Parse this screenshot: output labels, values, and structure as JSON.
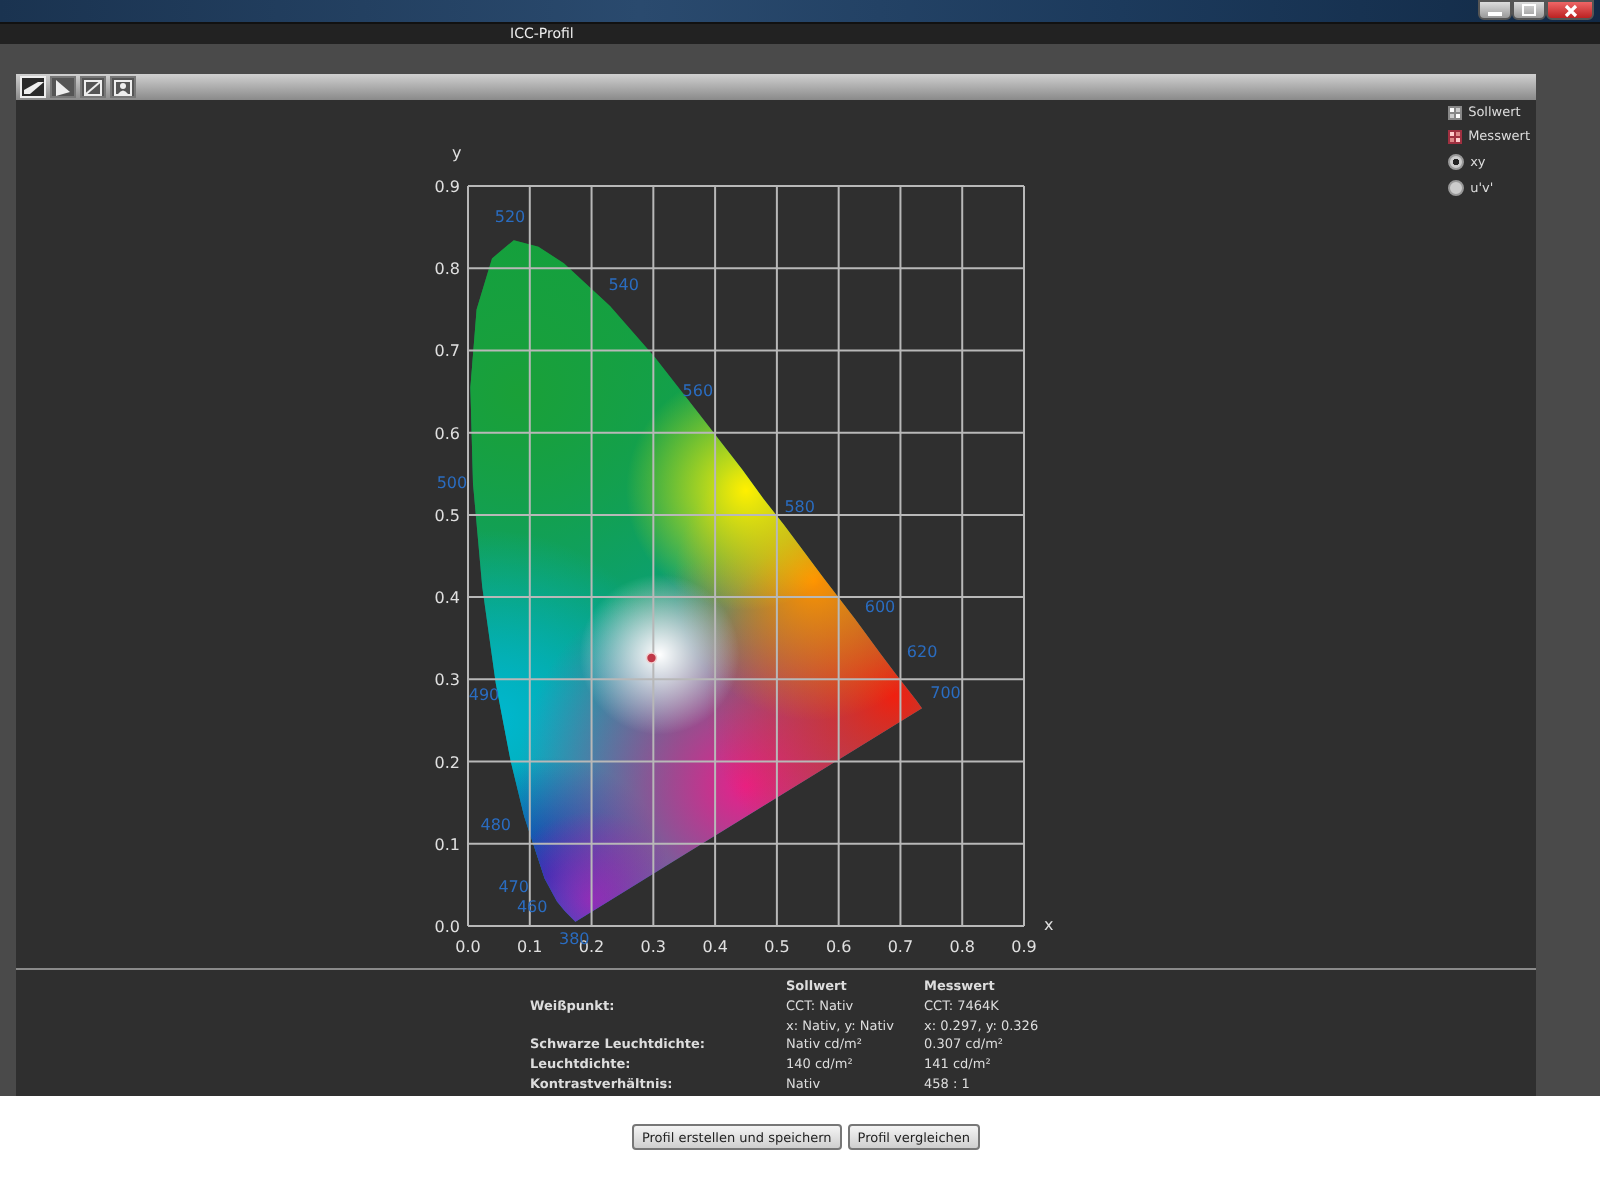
{
  "window": {
    "title": "ICC-Profil"
  },
  "toolbar_tabs": [
    {
      "selected": true
    },
    {
      "selected": false
    },
    {
      "selected": false
    },
    {
      "selected": false
    }
  ],
  "chart": {
    "chart_data": {
      "type": "scatter",
      "grid": true,
      "xlabel": "x",
      "ylabel": "y",
      "xlim": [
        0,
        0.9
      ],
      "ylim": [
        0,
        0.9
      ],
      "xticks": [
        {
          "value": 0,
          "label": "0.0"
        },
        {
          "value": 0.1,
          "label": "0.1"
        },
        {
          "value": 0.2,
          "label": "0.2"
        },
        {
          "value": 0.3,
          "label": "0.3"
        },
        {
          "value": 0.4,
          "label": "0.4"
        },
        {
          "value": 0.5,
          "label": "0.5"
        },
        {
          "value": 0.6,
          "label": "0.6"
        },
        {
          "value": 0.7,
          "label": "0.7"
        },
        {
          "value": 0.8,
          "label": "0.8"
        },
        {
          "value": 0.9,
          "label": "0.9"
        }
      ],
      "yticks": [
        {
          "value": 0,
          "label": "0.0"
        },
        {
          "value": 0.1,
          "label": "0.1"
        },
        {
          "value": 0.2,
          "label": "0.2"
        },
        {
          "value": 0.3,
          "label": "0.3"
        },
        {
          "value": 0.4,
          "label": "0.4"
        },
        {
          "value": 0.5,
          "label": "0.5"
        },
        {
          "value": 0.6,
          "label": "0.6"
        },
        {
          "value": 0.7,
          "label": "0.7"
        },
        {
          "value": 0.8,
          "label": "0.8"
        },
        {
          "value": 0.9,
          "label": "0.9"
        }
      ],
      "series": [
        {
          "color": "#c03848",
          "x": [
            0.297
          ],
          "values": [
            0.326
          ]
        }
      ],
      "annotations": [
        "520",
        "540",
        "560",
        "580",
        "600",
        "620",
        "700",
        "500",
        "490",
        "480",
        "470",
        "460",
        "380"
      ]
    }
  },
  "legend": [
    {
      "label": "Sollwert",
      "kind": "target"
    },
    {
      "label": "Messwert",
      "kind": "measured"
    }
  ],
  "view_options": [
    {
      "label": "xy",
      "selected": true
    },
    {
      "label": "u'v'",
      "selected": false
    }
  ],
  "table": {
    "columns": [
      "Sollwert",
      "Messwert"
    ],
    "rows": [
      {
        "label": "Weißpunkt:",
        "values": [
          "CCT: Nativ",
          "CCT: 7464K"
        ]
      },
      {
        "values": [
          "x: Nativ, y: Nativ",
          "x: 0.297, y: 0.326"
        ]
      },
      {
        "label": "Schwarze Leuchtdichte:",
        "values": [
          "Nativ cd/m²",
          "0.307 cd/m²"
        ]
      },
      {
        "label": "Leuchtdichte:",
        "values": [
          "140 cd/m²",
          "141 cd/m²"
        ]
      },
      {
        "label": "Kontrastverhältnis:",
        "values": [
          "Nativ",
          "458 : 1"
        ]
      }
    ]
  },
  "buttons": [
    "Profil erstellen und speichern",
    "Profil vergleichen"
  ]
}
